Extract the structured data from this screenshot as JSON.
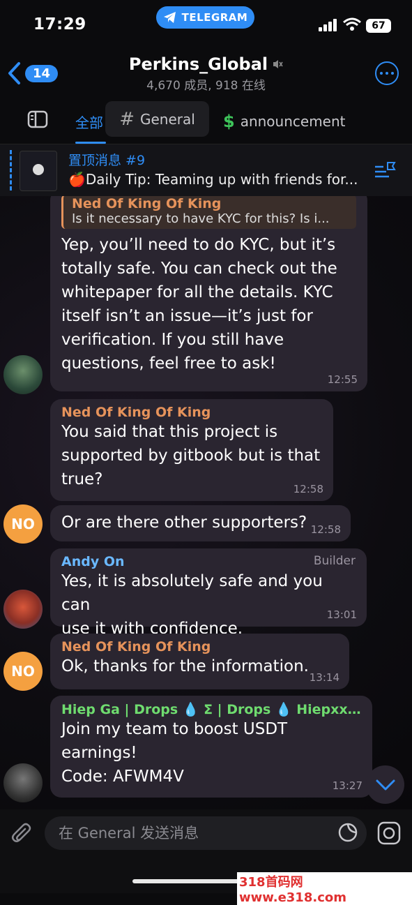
{
  "status_bar": {
    "time": "17:29",
    "app_pill": "TELEGRAM",
    "battery": "67"
  },
  "header": {
    "back_count": "14",
    "title": "Perkins_Global",
    "subtitle": "4,670 成员, 918 在线"
  },
  "tabs": {
    "all": "全部",
    "general": "General",
    "general_icon": "#",
    "announcement": "announcement",
    "announcement_icon": "$"
  },
  "pinned": {
    "title": "置顶消息 #9",
    "text": "🍎Daily Tip: Teaming up with friends for..."
  },
  "messages": [
    {
      "reply_name": "Ned Of King Of King",
      "reply_text": "Is it necessary to have KYC for this? Is i...",
      "lines": [
        "Yep, you’ll need to do KYC, but it’s",
        "totally safe. You can check out the",
        "whitepaper for all the details. KYC",
        "itself isn’t an issue—it’s just for",
        "verification. If you still have",
        "questions, feel free to ask!"
      ],
      "time": "12:55"
    },
    {
      "sender": "Ned Of King Of King",
      "lines": [
        "You said that this project is",
        "supported by gitbook but is that",
        "true?"
      ],
      "time": "12:58"
    },
    {
      "text": "Or are there other supporters?",
      "time": "12:58",
      "avatar": "NO"
    },
    {
      "sender": "Andy On",
      "role": "Builder",
      "lines": [
        "Yes, it is absolutely safe and you can",
        "use it with confidence."
      ],
      "time": "13:01"
    },
    {
      "sender": "Ned Of King Of King",
      "text": "Ok, thanks for the information.",
      "time": "13:14",
      "avatar": "NO"
    },
    {
      "sender": "Hiep Ga | Drops 💧 Σ | Drops 💧  Hiepxxx...",
      "lines": [
        "Join my team to boost USDT",
        "earnings!",
        "Code: AFWM4V"
      ],
      "time": "13:27"
    }
  ],
  "input": {
    "placeholder": "在 General 发送消息"
  },
  "watermark": "318首码网 www.e318.com",
  "colors": {
    "accent": "#2f8df5",
    "orange_name": "#e6935b",
    "green_name": "#6fdc6f",
    "blue_name": "#6ab8ff",
    "bubble": "#2a2530"
  }
}
